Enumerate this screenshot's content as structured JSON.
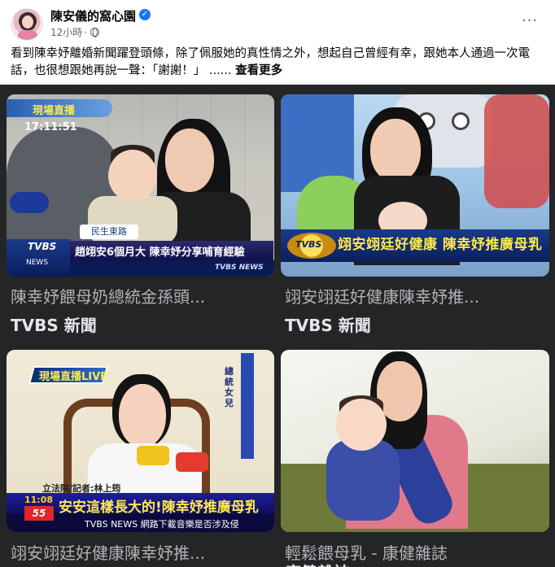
{
  "post": {
    "page_name": "陳安儀的窩心園",
    "time": "12小時",
    "separator": "·",
    "more_glyph": "···",
    "verified_glyph": "✓",
    "text": "看到陳幸妤離婚新聞躍登頭條，除了佩服她的真性情之外，想起自己曾經有幸，跟她本人通過一次電話，也很想跟她再說一聲：「謝謝！」 ...... ",
    "see_more": "查看更多"
  },
  "cards": [
    {
      "title": "陳幸妤餵母奶總統金孫頭...",
      "source": "TVBS 新聞",
      "thumb": {
        "live": "現場直播",
        "time": "17:11:51",
        "location": "民生東路",
        "logo": "TVBS",
        "logo_sub": "NEWS",
        "headline": "趙翊安6個月大 陳幸妤分享哺育經驗",
        "corner": "TVBS NEWS"
      }
    },
    {
      "title": "翊安翊廷好健康陳幸妤推...",
      "source": "TVBS 新聞",
      "thumb": {
        "logo": "TVBS",
        "headline": "翊安翊廷好健康 陳幸妤推廣母乳"
      }
    },
    {
      "title": "翊安翊廷好健康陳幸妤推...",
      "source": "",
      "thumb": {
        "live": "現場直播LIVE",
        "side": "總統女兒",
        "reporter": "立法院/記者:林上筠",
        "time": "11:08",
        "headline": "安安這樣長大的!陳幸妤推廣母乳",
        "channel": "55",
        "ticker": "TVBS NEWS  網路下載音樂是否涉及侵"
      }
    },
    {
      "title": "輕鬆餵母乳 - 康健雜誌",
      "source": "康健雜誌",
      "thumb": {}
    }
  ]
}
